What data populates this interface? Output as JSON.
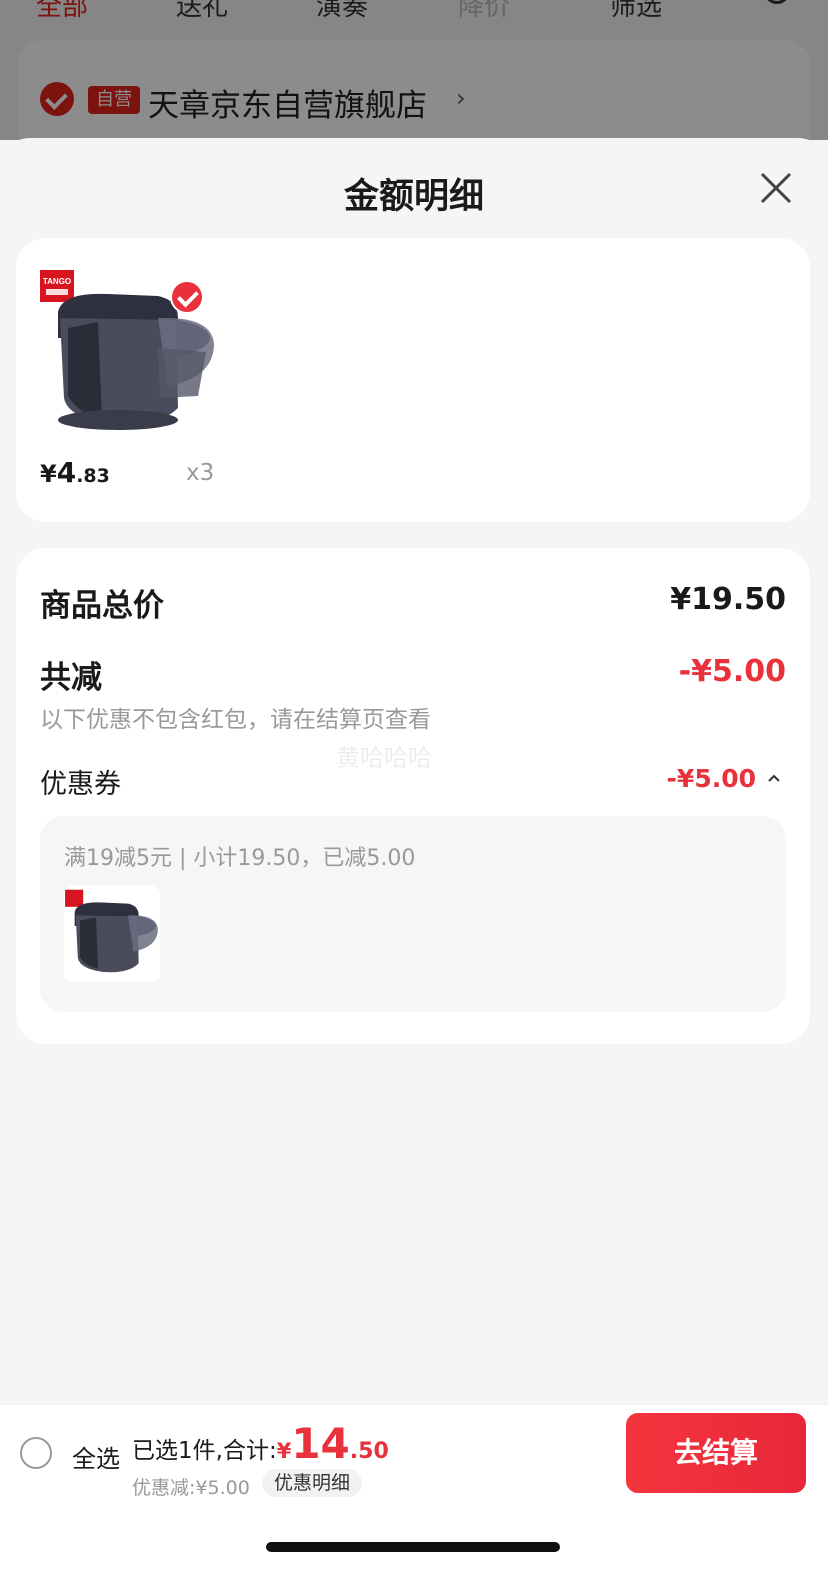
{
  "background": {
    "tabs": [
      "全部",
      "送礼",
      "演奏",
      "降价",
      "筛选"
    ],
    "store_badge": "自营",
    "store_name": "天章京东自营旗舰店"
  },
  "sheet": {
    "title": "金额明细",
    "product": {
      "price_symbol": "¥",
      "price_int": "4",
      "price_dec": ".83",
      "quantity": "x3",
      "brand_logo_text": "TANGO"
    },
    "summary": {
      "goods_total_label": "商品总价",
      "goods_total_value": "¥19.50",
      "reduce_label": "共减",
      "reduce_value": "-¥5.00",
      "note": "以下优惠不包含红包，请在结算页查看",
      "watermark": "黄哈哈哈",
      "coupon_label": "优惠券",
      "coupon_value": "-¥5.00",
      "coupon_rule": "满19减5元 | 小计19.50，已减5.00"
    }
  },
  "bottom_bar": {
    "select_all": "全选",
    "selected_text": "已选1件,合计:",
    "total_symbol": "¥",
    "total_int": "14",
    "total_dec": ".50",
    "discount_text": "优惠减:¥5.00",
    "detail_chip": "优惠明细",
    "checkout": "去结算"
  },
  "colors": {
    "accent_red": "#e8313a",
    "jd_red": "#e2231a"
  },
  "icons": {
    "close": "close-icon",
    "check": "check-icon",
    "caret": "chevron-up-icon",
    "search": "search-icon"
  }
}
